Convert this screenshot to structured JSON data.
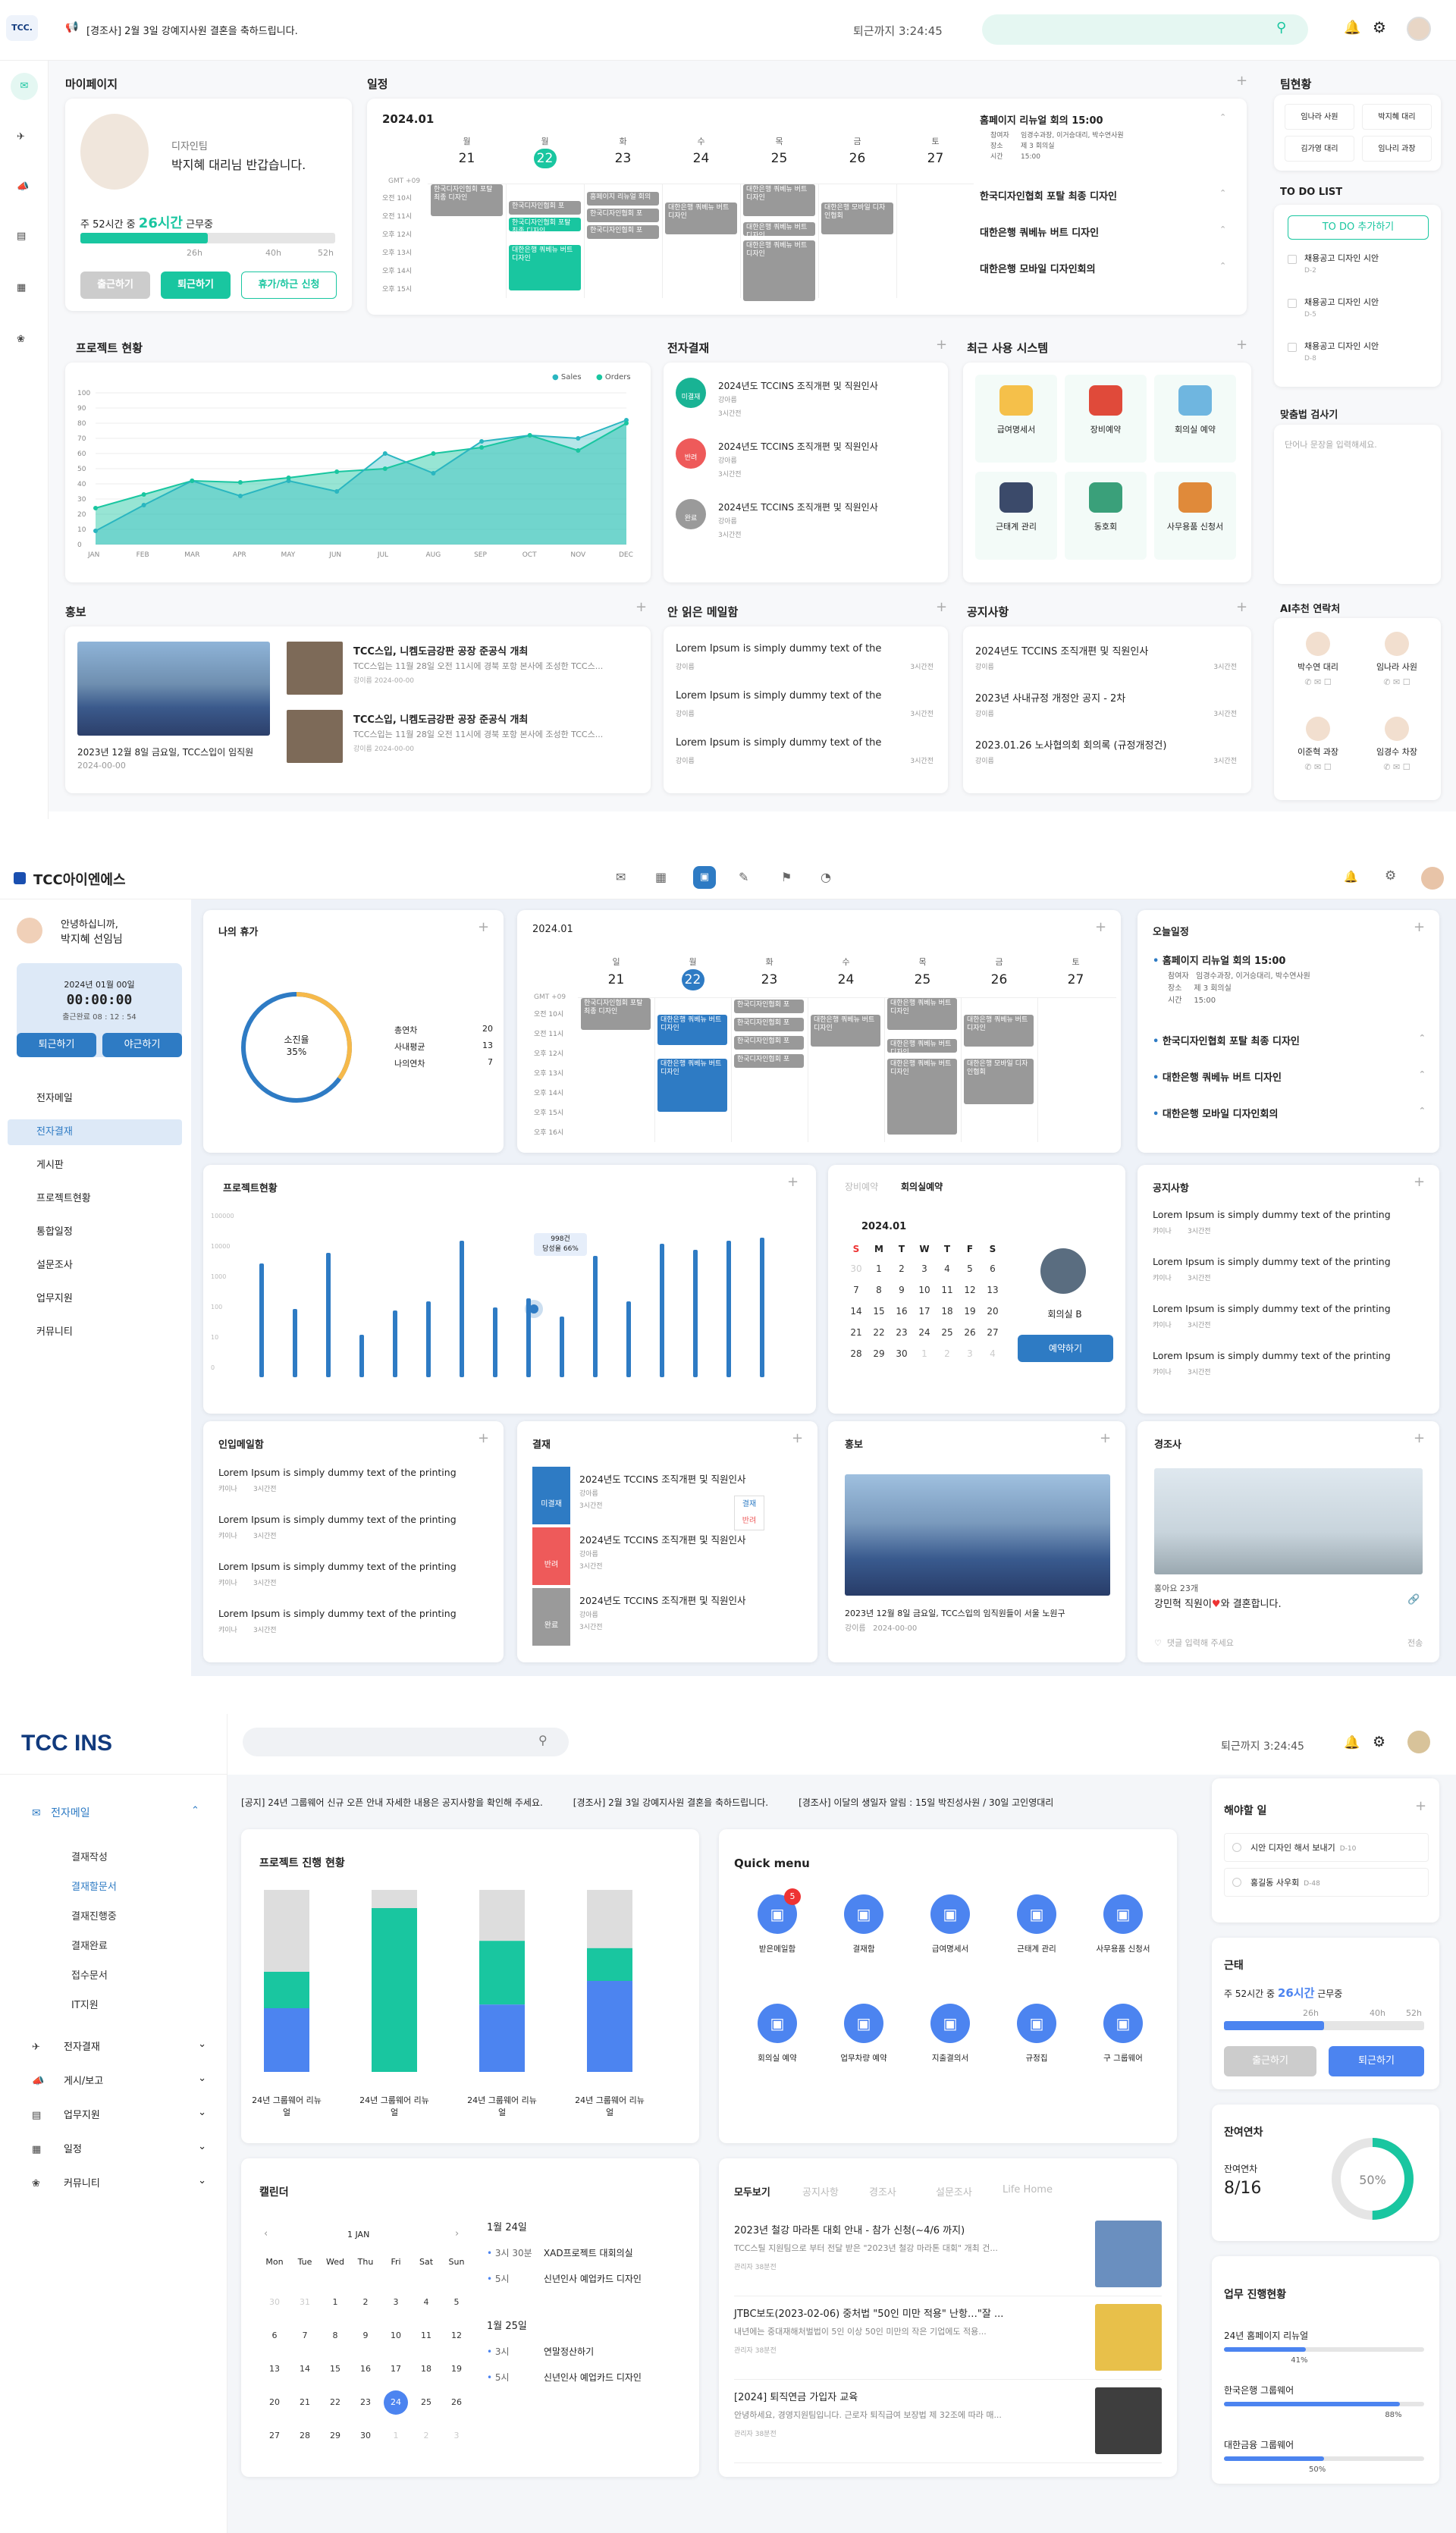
{
  "colors": {
    "mint": "#19c6a0",
    "blue1": "#2e7bc4",
    "blue3": "#4c84f0",
    "navy": "#0f3e8a"
  },
  "s1": {
    "logo": "TCC.",
    "notice": "[경조사] 2월 3일 강예지사원 결혼을 축하드립니다.",
    "leave_time": "퇴근까지 3:24:45",
    "mypage": {
      "title": "마이페이지",
      "dept": "디자인팀",
      "greet": "박지혜 대리님 반갑습니다.",
      "week_prefix": "주 52시간 중",
      "week_hours": "26시간",
      "week_suffix": "근무중",
      "progress": 0.5,
      "t1": "26h",
      "t2": "40h",
      "t3": "52h",
      "btn_in": "출근하기",
      "btn_out": "퇴근하기",
      "btn_leave": "휴가/하근 신청"
    },
    "cal": {
      "title": "일정",
      "month": "2024.01",
      "days": [
        {
          "w": "월",
          "d": "21"
        },
        {
          "w": "월",
          "d": "22"
        },
        {
          "w": "화",
          "d": "23"
        },
        {
          "w": "수",
          "d": "24"
        },
        {
          "w": "목",
          "d": "25"
        },
        {
          "w": "금",
          "d": "26"
        },
        {
          "w": "토",
          "d": "27"
        }
      ],
      "tz": "GMT +09",
      "times": [
        "오전 10시",
        "오전 11시",
        "오후 12시",
        "오후 13시",
        "오후 14시",
        "오후 15시"
      ],
      "events": [
        "한국디자인협회 포탈 최종 디자인",
        "한국디자인협회 포",
        "한국디자인협회 포탈 최종 디자인",
        "대한은행 쿼베뉴 버트 디자인",
        "홈페이지 리뉴얼 회의",
        "한국디자인협회 포",
        "한국디자인협회 포",
        "대한은행 쿼베뉴 버트 디자인",
        "대한은행 쿼베뉴 버트 디자인",
        "대한은행 쿼베뉴 버트 디자인",
        "대한은행 쿼베뉴 버트 디자인",
        "대한은행 모바일 디자인협회"
      ],
      "side": [
        {
          "t": "홈페이지 리뉴얼 회의 15:00",
          "r1": "참여자",
          "v1": "임경수과장, 이거승대리, 박수연사원",
          "r2": "장소",
          "v2": "제 3 회의실",
          "r3": "시간",
          "v3": "15:00"
        },
        {
          "t": "한국디자인협회 포탈 최종 디자인"
        },
        {
          "t": "대한은행 쿼베뉴 버트 디자인"
        },
        {
          "t": "대한은행 모바일 디자인회의"
        }
      ]
    },
    "team": {
      "title": "팀현황",
      "m": [
        "임나라 사원",
        "박지혜 대리",
        "김가영 대리",
        "임나리 과장"
      ],
      "todo_title": "TO DO LIST",
      "todo_btn": "TO DO 추가하기",
      "todos": [
        {
          "t": "채용공고 디자인 시안",
          "d": "D-2"
        },
        {
          "t": "채용공고 디자인 시안",
          "d": "D-5"
        },
        {
          "t": "채용공고 디자인 시안",
          "d": "D-8"
        }
      ],
      "spell_title": "맞춤법 검사기",
      "spell_ph": "단어나 문장을 입력해세요.",
      "ai_title": "AI추천 연락처",
      "ai": [
        "박수연 대리",
        "임나라 사원",
        "이준혁 과장",
        "임경수 차장"
      ]
    },
    "proj": {
      "title": "프로젝트 현황",
      "legend": [
        "Sales",
        "Orders"
      ],
      "yt": [
        "100",
        "90",
        "80",
        "70",
        "60",
        "50",
        "40",
        "30",
        "20",
        "10",
        "0"
      ],
      "months": [
        "JAN",
        "FEB",
        "MAR",
        "APR",
        "MAY",
        "JUN",
        "JUL",
        "AUG",
        "SEP",
        "OCT",
        "NOV",
        "DEC"
      ]
    },
    "pay": {
      "title": "전자결재",
      "items": [
        {
          "b": "미결재",
          "t": "2024년도 TCCINS 조직개편 및 직원인사",
          "s": "강아름",
          "time": "3시간전",
          "c": "#19b394"
        },
        {
          "b": "반려",
          "t": "2024년도 TCCINS 조직개편 및 직원인사",
          "s": "강아름",
          "time": "3시간전",
          "c": "#ee5a5a"
        },
        {
          "b": "완료",
          "t": "2024년도 TCCINS 조직개편 및 직원인사",
          "s": "강아름",
          "time": "3시간전",
          "c": "#9a9a9a"
        }
      ]
    },
    "sys": {
      "title": "최근 사용 시스템",
      "items": [
        "급여명세서",
        "장비예약",
        "회의실 예약",
        "근태계 관리",
        "동호회",
        "사무용품 신청서"
      ]
    },
    "pr": {
      "title": "홍보",
      "cap": "2023년 12월 8일 금요일, TCC스입이 임직원",
      "date": "2024-00-00",
      "items": [
        {
          "t": "TCC스입, 니켐도금강판 공장 준공식 개최",
          "b": "TCC스입는 11월 28일 오전 11시에 경북 포항 본사에 조성한 TCC스...",
          "a": "강이름",
          "d": "2024-00-00"
        },
        {
          "t": "TCC스입, 니켐도금강판 공장 준공식 개최",
          "b": "TCC스입는 11월 28일 오전 11시에 경북 포항 본사에 조성한 TCC스...",
          "a": "강이름",
          "d": "2024-00-00"
        }
      ]
    },
    "unread": {
      "title": "안 읽은 메일함",
      "items": [
        {
          "t": "Lorem Ipsum is simply dummy text of the",
          "a": "강이름",
          "d": "3시간전"
        },
        {
          "t": "Lorem Ipsum is simply dummy text of the",
          "a": "강이름",
          "d": "3시간전"
        },
        {
          "t": "Lorem Ipsum is simply dummy text of the",
          "a": "강이름",
          "d": "3시간전"
        }
      ]
    },
    "notice_list": {
      "title": "공지사항",
      "items": [
        {
          "t": "2024년도 TCCINS 조직개편 및 직원인사",
          "a": "강이름",
          "d": "3시간전"
        },
        {
          "t": "2023년 사내규정 개정안 공지 - 2차",
          "a": "강이름",
          "d": "3시간전"
        },
        {
          "t": "2023.01.26 노사협의회 회의록 (규정개정건)",
          "a": "강이름",
          "d": "3시간전"
        }
      ]
    }
  },
  "s2": {
    "logo": "TCC아이엔에스",
    "user": {
      "hi": "안녕하십니까,",
      "name": "박지혜 선임님",
      "date": "2024년 01월 00일",
      "clock": "00:00:00",
      "sub": "출근완료 08 : 12 : 54",
      "in": "퇴근하기",
      "out": "야근하기"
    },
    "nav": [
      "전자메일",
      "전자결재",
      "게시판",
      "프로젝트현황",
      "통합일정",
      "설문조사",
      "업무지원",
      "커뮤니티"
    ],
    "vac": {
      "title": "나의 휴가",
      "label": "소진율",
      "pct": "35%",
      "rows": [
        {
          "k": "총연차",
          "v": "20"
        },
        {
          "k": "사내평균",
          "v": "13"
        },
        {
          "k": "나의연차",
          "v": "7"
        }
      ],
      "ratio": 0.35
    },
    "cal": {
      "month": "2024.01",
      "days": [
        {
          "w": "일",
          "d": "21"
        },
        {
          "w": "월",
          "d": "22"
        },
        {
          "w": "화",
          "d": "23"
        },
        {
          "w": "수",
          "d": "24"
        },
        {
          "w": "목",
          "d": "25"
        },
        {
          "w": "금",
          "d": "26"
        },
        {
          "w": "토",
          "d": "27"
        }
      ],
      "tz": "GMT +09",
      "times": [
        "오전 10시",
        "오전 11시",
        "오후 12시",
        "오후 13시",
        "오후 14시",
        "오후 15시",
        "오후 16시"
      ]
    },
    "today": {
      "title": "오늘일정",
      "main": "홈페이지 리뉴얼 회의 15:00",
      "r1": "참여자",
      "v1": "임경수과장, 이거승대리, 박수연사원",
      "r2": "장소",
      "v2": "제 3 회의실",
      "r3": "시간",
      "v3": "15:00",
      "items": [
        "한국디자인협회 포탈 최종 디자인",
        "대한은행 쿼베뉴 버트 디자인",
        "대한은행 모바일 디자인회의"
      ]
    },
    "proj": {
      "title": "프로젝트현황",
      "tooltip1": "998건",
      "tooltip2": "당성율 66%",
      "ylabels": [
        "100000",
        "10000",
        "1000",
        "100",
        "10",
        "0"
      ]
    },
    "room": {
      "tab1": "장비예약",
      "tab2": "회의실예약",
      "month": "2024.01",
      "wd": [
        "S",
        "M",
        "T",
        "W",
        "T",
        "F",
        "S"
      ],
      "name": "회의실 B",
      "btn": "예약하기",
      "dates": [
        "30",
        "1",
        "2",
        "3",
        "4",
        "5",
        "6",
        "7",
        "8",
        "9",
        "10",
        "11",
        "12",
        "13",
        "14",
        "15",
        "16",
        "17",
        "18",
        "19",
        "20",
        "21",
        "22",
        "23",
        "24",
        "25",
        "26",
        "27",
        "28",
        "29",
        "30",
        "1",
        "2",
        "3",
        "4"
      ]
    },
    "notice": {
      "title": "공지사항",
      "items": [
        {
          "t": "Lorem Ipsum is simply dummy text of the printing",
          "a": "캬이나",
          "d": "3시간전"
        },
        {
          "t": "Lorem Ipsum is simply dummy text of the printing",
          "a": "캬이나",
          "d": "3시간전"
        },
        {
          "t": "Lorem Ipsum is simply dummy text of the printing",
          "a": "캬이나",
          "d": "3시간전"
        },
        {
          "t": "Lorem Ipsum is simply dummy text of the printing",
          "a": "캬이나",
          "d": "3시간전"
        }
      ]
    },
    "mail": {
      "title": "인입메일함",
      "items": [
        {
          "t": "Lorem Ipsum is simply dummy text of the printing",
          "a": "캬이나",
          "d": "3시간전"
        },
        {
          "t": "Lorem Ipsum is simply dummy text of the printing",
          "a": "캬이나",
          "d": "3시간전"
        },
        {
          "t": "Lorem Ipsum is simply dummy text of the printing",
          "a": "캬이나",
          "d": "3시간전"
        },
        {
          "t": "Lorem Ipsum is simply dummy text of the printing",
          "a": "캬이나",
          "d": "3시간전"
        }
      ]
    },
    "pay": {
      "title": "결재",
      "items": [
        {
          "b": "미결재",
          "t": "2024년도 TCCINS 조직개편 및 직원인사",
          "s": "강아름",
          "time": "3시간전",
          "c": "#2e7bc4"
        },
        {
          "b": "반려",
          "t": "2024년도 TCCINS 조직개편 및 직원인사",
          "s": "강아름",
          "time": "3시간전",
          "c": "#ee5a5a"
        },
        {
          "b": "완료",
          "t": "2024년도 TCCINS 조직개편 및 직원인사",
          "s": "강아름",
          "time": "3시간전",
          "c": "#9a9a9a"
        }
      ],
      "pop1": "결재",
      "pop2": "반려"
    },
    "pr": {
      "title": "홍보",
      "cap": "2023년 12월 8일 금요일, TCC스입의 임직원들이 서울 노원구",
      "a": "강이름",
      "d": "2024-00-00"
    },
    "family": {
      "title": "경조사",
      "l1": "홍아요 23개",
      "l2": "강민혁",
      "l3": "직원이",
      "l4": "와 결혼합니다.",
      "comment": "댓글 입력해 주세요",
      "reg": "전송"
    }
  },
  "s3": {
    "logo": "TCC INS",
    "leave_time": "퇴근까지 3:24:45",
    "ticker": [
      "[공지] 24년 그룹웨어 신규 오픈 안내 자세한 내용은 공지사항을 확인해 주세요.",
      "[경조사] 2월 3일 강예지사원 결혼을 축하드립니다.",
      "[경조사] 이달의 생일자 알림 : 15일 박진성사원 / 30일 고인영대리"
    ],
    "menu": {
      "main": "전자메일",
      "subs": [
        "결재작성",
        "결재할문서",
        "결재진행중",
        "결재완료",
        "접수문서",
        "IT지원"
      ],
      "others": [
        "전자결재",
        "게시/보고",
        "업무지원",
        "일정",
        "커뮤니티"
      ]
    },
    "proj": {
      "title": "프로젝트 진행 현황",
      "labels": [
        "24년 그룹웨어 리뉴얼",
        "24년 그룹웨어 리뉴얼",
        "24년 그룹웨어 리뉴얼",
        "24년 그룹웨어 리뉴얼"
      ]
    },
    "quick": {
      "title": "Quick menu",
      "badge": "5",
      "items": [
        "받은메일함",
        "결재함",
        "급여명세서",
        "근태계 관리",
        "사무용품 신청서",
        "회의실 예약",
        "업무차량 예약",
        "지출결의서",
        "규정집",
        "구 그룹웨어"
      ]
    },
    "cal": {
      "title": "캘린더",
      "month": "1 JAN",
      "wd": [
        "Mon",
        "Tue",
        "Wed",
        "Thu",
        "Fri",
        "Sat",
        "Sun"
      ],
      "dates": [
        "30",
        "31",
        "1",
        "2",
        "3",
        "4",
        "5",
        "6",
        "7",
        "8",
        "9",
        "10",
        "11",
        "12",
        "13",
        "14",
        "15",
        "16",
        "17",
        "18",
        "19",
        "20",
        "21",
        "22",
        "23",
        "24",
        "25",
        "26",
        "27",
        "28",
        "29",
        "30",
        "1",
        "2",
        "3"
      ],
      "d1": "1월 24일",
      "e1": [
        {
          "t": "3시 30분",
          "n": "XAD프로젝트 대회의실"
        },
        {
          "t": "5시",
          "n": "신년인사 예업카드 디자인"
        }
      ],
      "d2": "1월 25일",
      "e2": [
        {
          "t": "3시",
          "n": "연말정산하기"
        },
        {
          "t": "5시",
          "n": "신년인사 예업카드 디자인"
        }
      ]
    },
    "news": {
      "tabs": [
        "모두보기",
        "공지사항",
        "경조사",
        "설문조사",
        "Life Home"
      ],
      "items": [
        {
          "t": "2023년 철강 마라톤 대회 안내 - 참가 신청(~4/6 까지)",
          "b": "TCC스틸 지원팀으로 부터 전달 받은 \"2023년 철강 마라톤 대회\" 개최 건...",
          "a": "관리자",
          "d": "38분전"
        },
        {
          "t": "JTBC보도(2023-02-06) 중처법 \"50인 미만 적용\" 난항…\"잘 ...",
          "b": "내년에는 중대재해처벌법이 5인 이상 50인 미만의 작은 기업에도 적용...",
          "a": "관리자",
          "d": "38분전"
        },
        {
          "t": "[2024] 퇴직연금 가입자 교육",
          "b": "안녕하세요, 경영지원팀입니다. 근로자 퇴직급여 보장법 제 32조에 따라 매...",
          "a": "관리자",
          "d": "38분전"
        }
      ]
    },
    "holiday": {
      "title": "해야할 일",
      "items": [
        {
          "t": "시안 디자인 해서 보내기",
          "d": "D-10"
        },
        {
          "t": "홍길동 사우회",
          "d": "D-48"
        }
      ]
    },
    "work": {
      "title": "근태",
      "prefix": "주 52시간 중",
      "hours": "26시간",
      "suffix": "근무중",
      "t1": "26h",
      "t2": "40h",
      "t3": "52h",
      "in": "출근하기",
      "out": "퇴근하기",
      "progress": 0.5
    },
    "annual": {
      "title": "잔여연차",
      "label": "잔여연차",
      "val": "8/16",
      "pct": "50%",
      "ratio": 0.5
    },
    "task": {
      "title": "업무 진행현황",
      "items": [
        {
          "n": "24년 홈페이지 리뉴얼",
          "p": "41%",
          "v": 0.41
        },
        {
          "n": "한국은행 그룹웨어",
          "p": "88%",
          "v": 0.88
        },
        {
          "n": "대한금융 그룹웨어",
          "p": "50%",
          "v": 0.5
        }
      ]
    }
  }
}
